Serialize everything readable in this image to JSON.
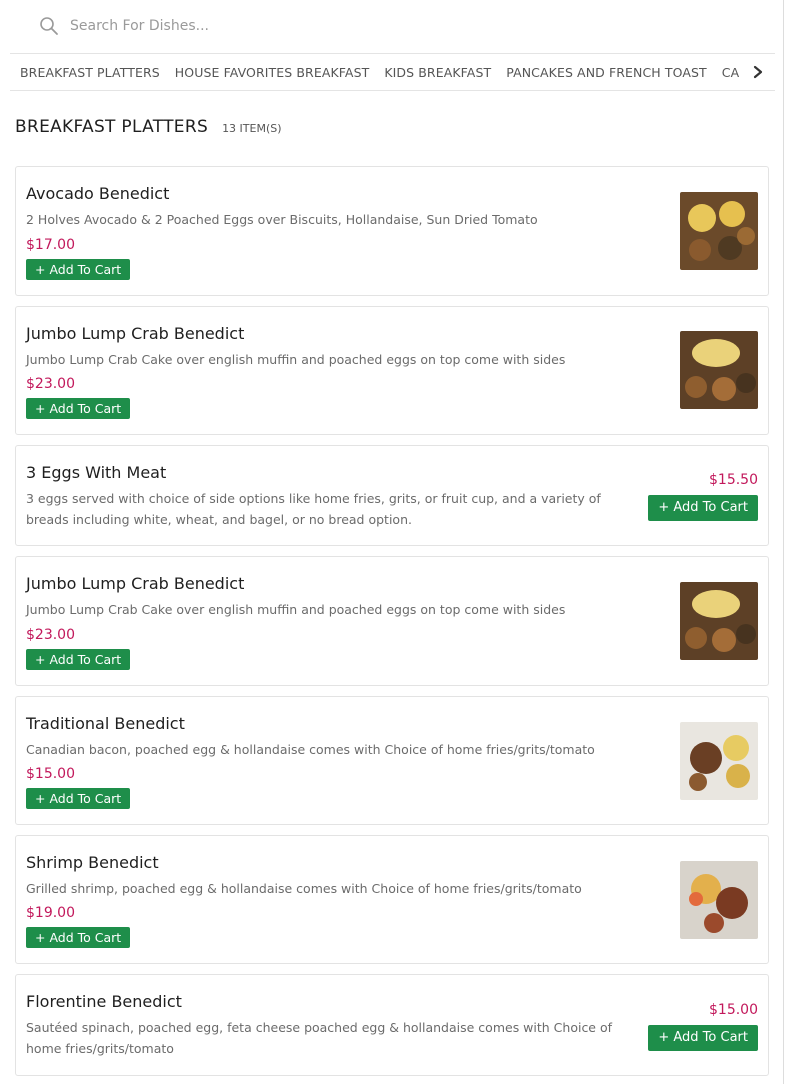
{
  "search": {
    "placeholder": "Search For Dishes..."
  },
  "categories": [
    "BREAKFAST PLATTERS",
    "HOUSE FAVORITES BREAKFAST",
    "KIDS BREAKFAST",
    "PANCAKES AND FRENCH TOAST",
    "CA"
  ],
  "section": {
    "title": "BREAKFAST PLATTERS",
    "count": "13 ITEM(S)"
  },
  "add_label": "+ Add To Cart",
  "colors": {
    "price": "#c2185b",
    "button": "#1e8e4a"
  },
  "items": [
    {
      "name": "Avocado Benedict",
      "description": "2 Holves Avocado & 2 Poached Eggs over Biscuits, Hollandaise, Sun Dried Tomato",
      "price": "$17.00",
      "has_image": true
    },
    {
      "name": "Jumbo Lump Crab Benedict",
      "description": "Jumbo Lump Crab Cake over english muffin and poached eggs on top come with sides",
      "price": "$23.00",
      "has_image": true
    },
    {
      "name": "3 Eggs With Meat",
      "description": "3 eggs served with choice of side options like home fries, grits, or fruit cup, and a variety of breads including white, wheat, and bagel, or no bread option.",
      "price": "$15.50",
      "has_image": false
    },
    {
      "name": "Jumbo Lump Crab Benedict",
      "description": "Jumbo Lump Crab Cake over english muffin and poached eggs on top come with sides",
      "price": "$23.00",
      "has_image": true
    },
    {
      "name": "Traditional Benedict",
      "description": "Canadian bacon, poached egg & hollandaise comes with Choice of home fries/grits/tomato",
      "price": "$15.00",
      "has_image": true
    },
    {
      "name": "Shrimp Benedict",
      "description": "Grilled shrimp, poached egg & hollandaise comes with Choice of home fries/grits/tomato",
      "price": "$19.00",
      "has_image": true
    },
    {
      "name": "Florentine Benedict",
      "description": "Sautéed spinach, poached egg, feta cheese poached egg & hollandaise comes with Choice of home fries/grits/tomato",
      "price": "$15.00",
      "has_image": false
    }
  ]
}
